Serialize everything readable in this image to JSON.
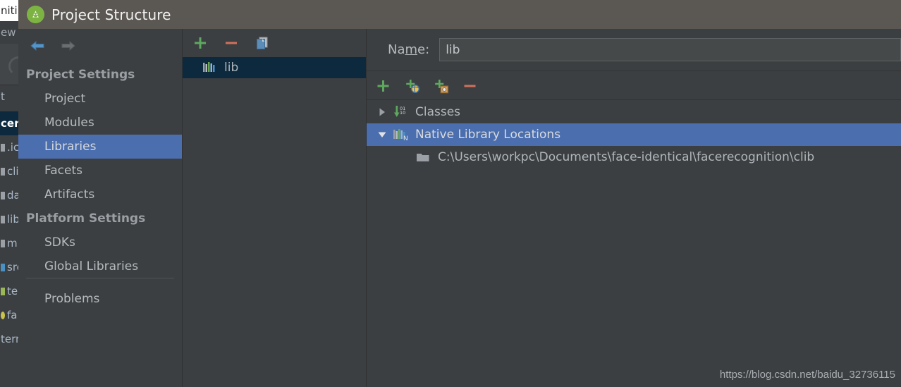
{
  "window": {
    "title": "Project Structure",
    "logo_icon": "android-studio-icon"
  },
  "background_ide": {
    "top_bar_text": "niti",
    "menu_text": "ew",
    "editor_tab_text": "t",
    "rows": [
      {
        "label": "cere",
        "selected": true,
        "chip": "none"
      },
      {
        "label": ".ic",
        "selected": false,
        "chip": "gray"
      },
      {
        "label": "cli",
        "selected": false,
        "chip": "gray"
      },
      {
        "label": "da",
        "selected": false,
        "chip": "gray"
      },
      {
        "label": "lib",
        "selected": false,
        "chip": "gray"
      },
      {
        "label": "m",
        "selected": false,
        "chip": "gray"
      },
      {
        "label": "src",
        "selected": false,
        "chip": "blue"
      },
      {
        "label": "te",
        "selected": false,
        "chip": "green"
      },
      {
        "label": "fa",
        "selected": false,
        "chip": "yellow"
      },
      {
        "label": "tern",
        "selected": false,
        "chip": "none"
      }
    ]
  },
  "navigation": {
    "back_icon": "arrow-left-icon",
    "forward_icon": "arrow-right-icon",
    "back_enabled": true,
    "forward_enabled": false,
    "groups": [
      {
        "title": "Project Settings",
        "items": [
          {
            "label": "Project",
            "selected": false
          },
          {
            "label": "Modules",
            "selected": false
          },
          {
            "label": "Libraries",
            "selected": true
          },
          {
            "label": "Facets",
            "selected": false
          },
          {
            "label": "Artifacts",
            "selected": false
          }
        ]
      },
      {
        "title": "Platform Settings",
        "items": [
          {
            "label": "SDKs",
            "selected": false
          },
          {
            "label": "Global Libraries",
            "selected": false
          }
        ]
      }
    ],
    "problems_label": "Problems"
  },
  "libraries_panel": {
    "toolbar": [
      {
        "name": "add-library-button",
        "icon": "plus-icon"
      },
      {
        "name": "remove-library-button",
        "icon": "minus-icon"
      },
      {
        "name": "copy-library-button",
        "icon": "copy-icon"
      }
    ],
    "items": [
      {
        "label": "lib",
        "icon": "library-icon",
        "selected": true
      }
    ]
  },
  "details_panel": {
    "name_label_prefix": "Na",
    "name_label_mnemonic": "m",
    "name_label_suffix": "e:",
    "name_value": "lib",
    "name_placeholder": "",
    "toolbar": [
      {
        "name": "add-button",
        "icon": "plus-icon"
      },
      {
        "name": "add-url-button",
        "icon": "plus-globe-icon"
      },
      {
        "name": "add-jar-button",
        "icon": "plus-archive-icon"
      },
      {
        "name": "remove-button",
        "icon": "minus-icon"
      }
    ],
    "tree": [
      {
        "label": "Classes",
        "icon": "classes-icon",
        "twisty": "collapsed",
        "selected": false,
        "level": 0
      },
      {
        "label": "Native Library Locations",
        "icon": "native-library-icon",
        "twisty": "expanded",
        "selected": true,
        "level": 0
      },
      {
        "label": "C:\\Users\\workpc\\Documents\\face-identical\\facerecognition\\clib",
        "icon": "folder-icon",
        "twisty": "none",
        "selected": false,
        "level": 1
      }
    ]
  },
  "watermark": {
    "text": "https://blog.csdn.net/baidu_32736115"
  },
  "colors": {
    "titlebar": "#5b5753",
    "dialog_bg": "#3c3f41",
    "selection_blue": "#4b6eaf",
    "inactive_selection": "#0d293e",
    "accent_green": "#58a758",
    "accent_red": "#c75450",
    "text": "#b6bbbf"
  }
}
